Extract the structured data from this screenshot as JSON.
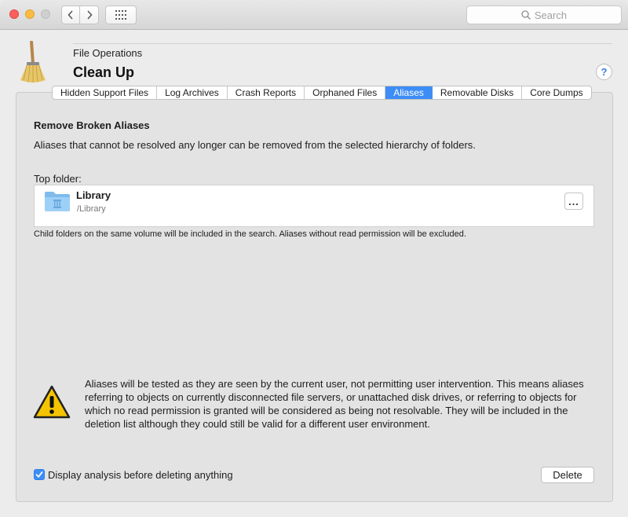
{
  "toolbar": {
    "search_placeholder": "Search",
    "icons": [
      "chevron-left-icon",
      "chevron-right-icon",
      "grid-icon",
      "search-icon"
    ]
  },
  "header": {
    "section": "File Operations",
    "title": "Clean Up",
    "help": "?"
  },
  "tabs": [
    {
      "label": "Hidden Support Files",
      "active": false
    },
    {
      "label": "Log Archives",
      "active": false
    },
    {
      "label": "Crash Reports",
      "active": false
    },
    {
      "label": "Orphaned Files",
      "active": false
    },
    {
      "label": "Aliases",
      "active": true
    },
    {
      "label": "Removable Disks",
      "active": false
    },
    {
      "label": "Core Dumps",
      "active": false
    }
  ],
  "main": {
    "heading": "Remove Broken Aliases",
    "description": "Aliases that cannot be resolved any longer can be removed from the selected hierarchy of folders.",
    "top_folder_label": "Top folder:",
    "folder": {
      "name": "Library",
      "path": "/Library",
      "more_label": "..."
    },
    "child_note": "Child folders on the same volume will be included in the search. Aliases without read permission will be excluded.",
    "warning": "Aliases will be tested as they are seen by the current user, not permitting user intervention. This means aliases referring to objects on currently disconnected file servers, or unattached disk drives, or referring to objects for which no read permission is granted will be considered as being not resolvable. They will be included in the deletion list although they could still be valid for a different user environment."
  },
  "footer": {
    "checkbox_label": "Display analysis before deleting anything",
    "checkbox_checked": true,
    "delete_label": "Delete"
  },
  "colors": {
    "accent": "#3d8df7",
    "window_bg": "#ececec",
    "panel_bg": "#e3e3e3"
  }
}
